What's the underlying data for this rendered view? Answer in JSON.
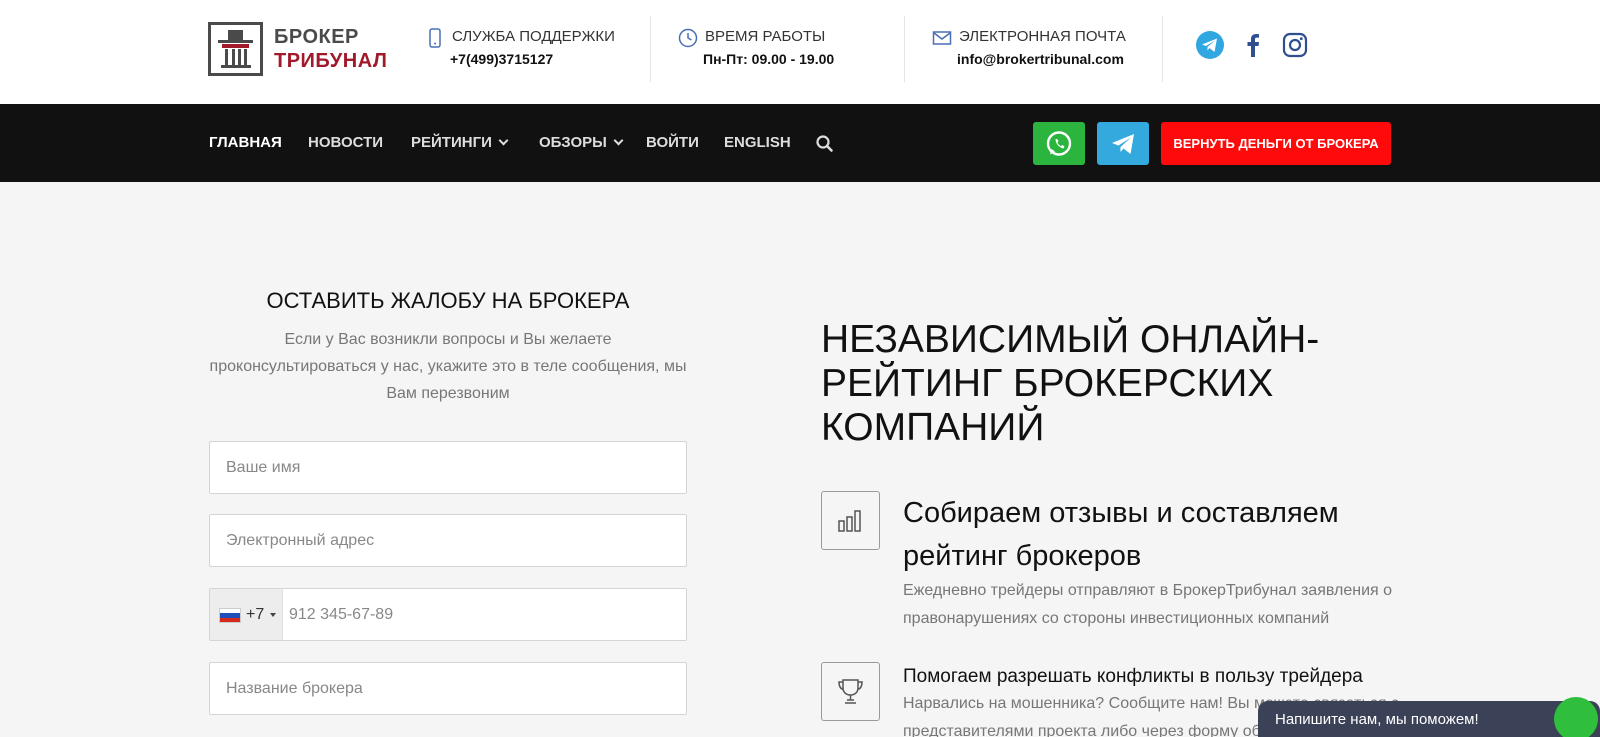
{
  "header": {
    "logo": {
      "line1": "БРОКЕР",
      "line2": "ТРИБУНАЛ"
    },
    "support": {
      "label": "СЛУЖБА ПОДДЕРЖКИ",
      "value": "+7(499)3715127",
      "icon": "phone-icon"
    },
    "hours": {
      "label": "ВРЕМЯ РАБОТЫ",
      "value": "Пн-Пт: 09.00 - 19.00",
      "icon": "clock-icon"
    },
    "email": {
      "label": "ЭЛЕКТРОННАЯ ПОЧТА",
      "value": "info@brokertribunal.com",
      "icon": "mail-icon"
    },
    "social": [
      "telegram-icon",
      "facebook-icon",
      "instagram-icon"
    ]
  },
  "nav": {
    "items": [
      {
        "label": "ГЛАВНАЯ",
        "active": true,
        "dropdown": false
      },
      {
        "label": "НОВОСТИ",
        "active": false,
        "dropdown": false
      },
      {
        "label": "РЕЙТИНГИ",
        "active": false,
        "dropdown": true
      },
      {
        "label": "ОБЗОРЫ",
        "active": false,
        "dropdown": true
      },
      {
        "label": "ВОЙТИ",
        "active": false,
        "dropdown": false
      },
      {
        "label": "ENGLISH",
        "active": false,
        "dropdown": false
      }
    ],
    "cta_label": "ВЕРНУТЬ ДЕНЬГИ ОТ БРОКЕРА"
  },
  "form": {
    "title": "ОСТАВИТЬ ЖАЛОБУ НА БРОКЕРА",
    "description": "Если у Вас возникли вопросы и Вы желаете проконсультироваться у нас, укажите это в теле сообщения, мы Вам перезвоним",
    "name_placeholder": "Ваше имя",
    "email_placeholder": "Электронный адрес",
    "phone_code": "+7",
    "phone_placeholder": "912 345-67-89",
    "broker_placeholder": "Название брокера"
  },
  "hero": {
    "title": "НЕЗАВИСИМЫЙ ОНЛАЙН-РЕЙТИНГ БРОКЕРСКИХ КОМПАНИЙ",
    "features": [
      {
        "icon": "bar-chart-icon",
        "title": "Собираем отзывы и составляем рейтинг брокеров",
        "text": "Ежедневно трейдеры отправляют в БрокерТрибунал заявления о правонарушениях со стороны инвестиционных компаний"
      },
      {
        "icon": "trophy-icon",
        "title": "Помогаем разрешать конфликты в пользу трейдера",
        "text": "Нарвались на мошенника? Сообщите нам! Вы можете связаться с представителями проекта либо через форму об"
      }
    ]
  },
  "chat": {
    "label": "Напишите нам, мы поможем!"
  },
  "colors": {
    "navbar": "#111111",
    "cta": "#ff0a0a",
    "whatsapp": "#2bb53f",
    "telegram": "#34a9dd",
    "brand_red": "#a11a2b"
  }
}
